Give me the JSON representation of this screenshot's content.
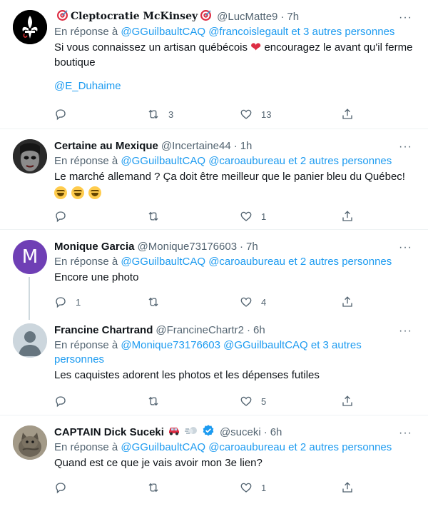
{
  "tweets": [
    {
      "name": "Cleptocratie McKinsey",
      "handle": "@LucMatte9",
      "time": "7h",
      "reply_prefix": "En réponse à",
      "reply_users": [
        "@GGuilbaultCAQ",
        "@francoislegault"
      ],
      "reply_more": "et 3 autres personnes",
      "text_a": "Si vous connaissez un artisan québécois",
      "text_b": "encouragez le avant qu'il ferme boutique",
      "text_link": "@E_Duhaime",
      "retweets": "3",
      "likes": "13",
      "avatar_color": "#000000"
    },
    {
      "name": "Certaine au Mexique",
      "handle": "@Incertaine44",
      "time": "1h",
      "reply_prefix": "En réponse à",
      "reply_users": [
        "@GGuilbaultCAQ",
        "@caroaubureau"
      ],
      "reply_more": "et 2 autres personnes",
      "text": "Le marché allemand ? Ça doit être meilleur que le panier bleu du Québec!",
      "likes": "1",
      "avatar_color": "#3a3a3a"
    },
    {
      "name": "Monique Garcia",
      "handle": "@Monique73176603",
      "time": "7h",
      "reply_prefix": "En réponse à",
      "reply_users": [
        "@GGuilbaultCAQ",
        "@caroaubureau"
      ],
      "reply_more": "et 2 autres personnes",
      "text": "Encore une photo",
      "replies": "1",
      "likes": "4",
      "avatar_letter": "M",
      "avatar_color": "#6f3fb5"
    },
    {
      "name": "Francine Chartrand",
      "handle": "@FrancineChartr2",
      "time": "6h",
      "reply_prefix": "En réponse à",
      "reply_users": [
        "@Monique73176603",
        "@GGuilbaultCAQ"
      ],
      "reply_more": "et 3 autres personnes",
      "text": "Les caquistes adorent les photos et les dépenses futiles",
      "likes": "5",
      "avatar_color": "#ccd6dd"
    },
    {
      "name": "CAPTAIN Dick Suceki",
      "handle": "@suceki",
      "time": "6h",
      "reply_prefix": "En réponse à",
      "reply_users": [
        "@GGuilbaultCAQ",
        "@caroaubureau"
      ],
      "reply_more": "et 2 autres personnes",
      "text": "Quand est ce que je vais avoir mon 3e lien?",
      "likes": "1",
      "avatar_color": "#8a8272"
    }
  ],
  "ui": {
    "more_glyph": "···",
    "dot": "·"
  },
  "colors": {
    "link": "#1d9bf0",
    "secondary": "#536471",
    "divider": "#eff3f4"
  }
}
